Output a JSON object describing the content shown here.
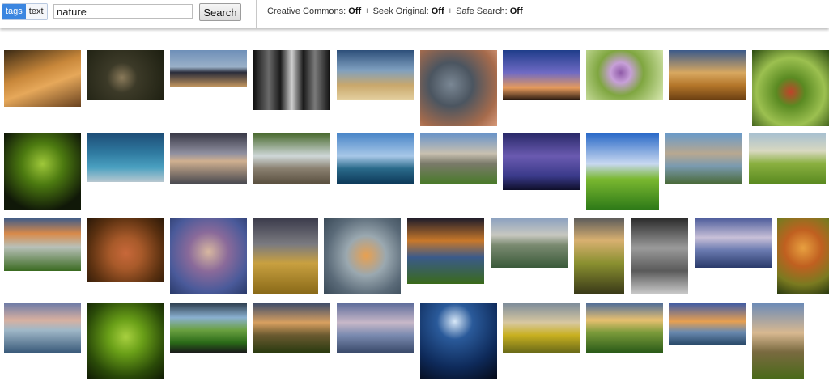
{
  "search": {
    "tab_tags": "tags",
    "tab_text": "text",
    "query": "nature",
    "button_label": "Search"
  },
  "options": {
    "creative_commons_label": "Creative Commons:",
    "creative_commons_value": "Off",
    "seek_original_label": "Seek Original:",
    "seek_original_value": "Off",
    "safe_search_label": "Safe Search:",
    "safe_search_value": "Off",
    "separator": "+"
  }
}
